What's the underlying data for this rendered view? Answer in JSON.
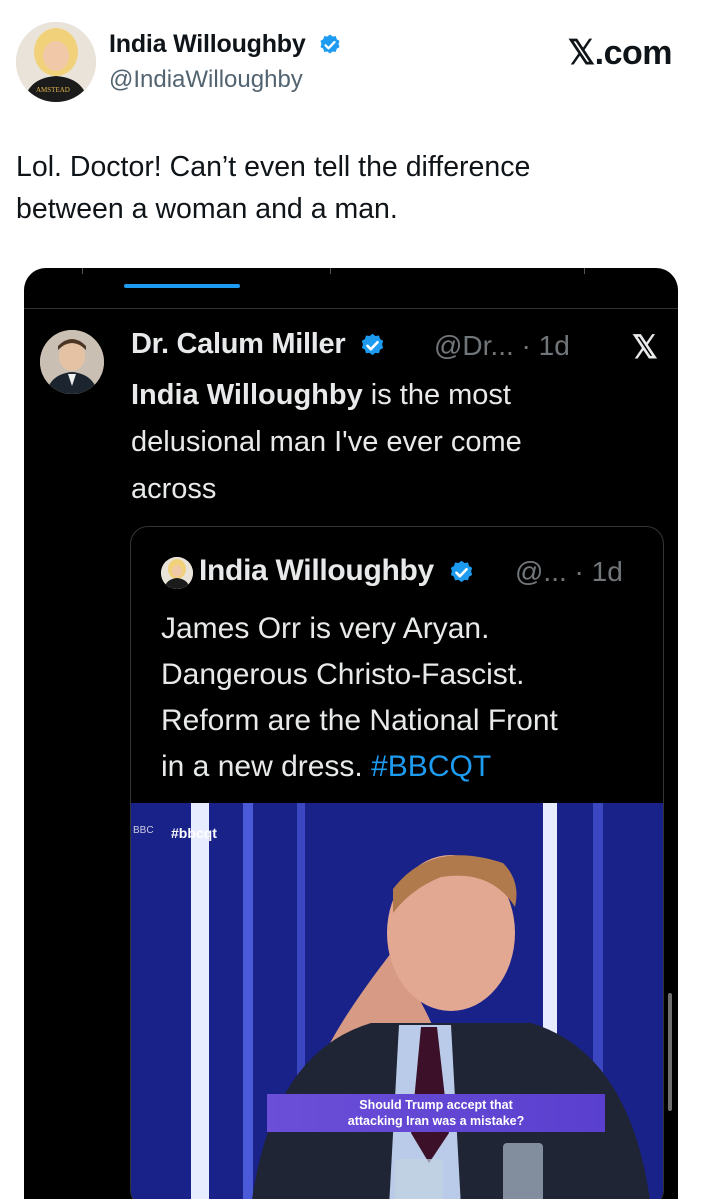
{
  "author": {
    "name": "India Willoughby",
    "handle": "@IndiaWilloughby"
  },
  "site_label": "𝕏.com",
  "tweet": {
    "line1": "Lol. Doctor! Can’t even tell the difference",
    "line2": "between a woman and a man."
  },
  "screenshot": {
    "reply": {
      "name": "Dr. Calum Miller",
      "meta": "@Dr... · 1d",
      "close_label": "𝕏",
      "mention": "India Willoughby",
      "text_rest": " is the most",
      "line2": "delusional man I've ever come",
      "line3": "across"
    },
    "quote": {
      "name": "India Willoughby",
      "meta": "@... · 1d",
      "line1": "James Orr is very Aryan.",
      "line2": "Dangerous Christo-Fascist.",
      "line3": "Reform are the National Front",
      "line4_text": "in a new dress. ",
      "hashtag": "#BBCQT",
      "photo": {
        "channel_tag": "#bbcqt",
        "logo": "BBC",
        "caption_line1": "Should Trump accept that",
        "caption_line2": "attacking Iran was a mistake?"
      }
    }
  },
  "colors": {
    "verified": "#1d9bf0",
    "hashtag": "#1d9bf0",
    "dark_bg": "#000000"
  }
}
